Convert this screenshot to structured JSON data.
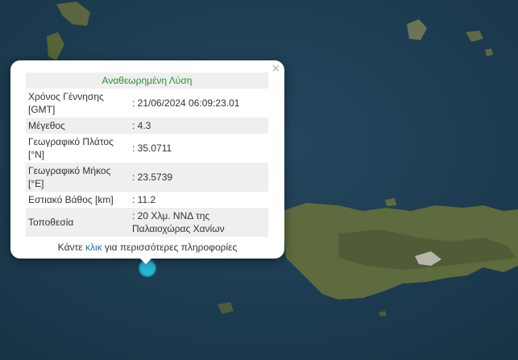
{
  "map": {
    "colors": {
      "sea": "#1f3f57",
      "land": "#5d6b3e",
      "land_dark": "#4a5634",
      "marker": "#29b6d6"
    },
    "marker_icon": "earthquake-marker-icon"
  },
  "popup": {
    "close_glyph": "×",
    "title": "Αναθεωρημένη Λύση",
    "rows": [
      {
        "label": "Χρόνος Γέννησης [GMT]",
        "value": ": 21/06/2024 06:09:23.01"
      },
      {
        "label": "Μέγεθος",
        "value": ": 4.3"
      },
      {
        "label": "Γεωγραφικό Πλάτος [°N]",
        "value": ": 35.0711"
      },
      {
        "label": "Γεωγραφικό Μήκος [°E]",
        "value": ": 23.5739"
      },
      {
        "label": "Εστιακό Βάθος [km]",
        "value": ": 11.2"
      },
      {
        "label": "Τοποθεσία",
        "value": ": 20 Χλμ. ΝΝΔ της Παλαιοχώρας Χανίων"
      }
    ],
    "more_prefix": "Κάντε ",
    "more_link": "κλικ",
    "more_suffix": " για περισσότερες πληροφορίες"
  }
}
